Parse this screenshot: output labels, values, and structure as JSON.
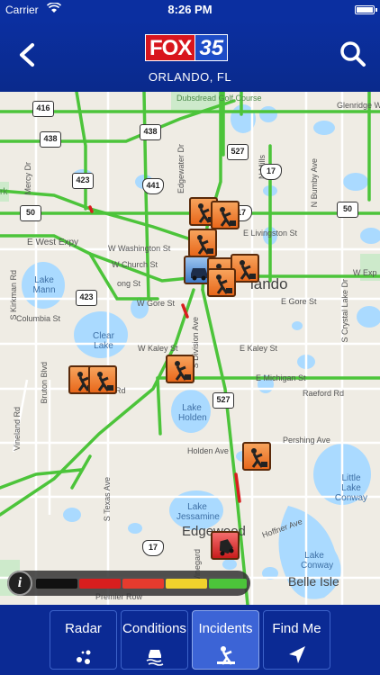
{
  "status_bar": {
    "carrier": "Carrier",
    "time": "8:26 PM"
  },
  "header": {
    "logo_fox": "FOX",
    "logo_number": "35",
    "location": "ORLANDO, FL"
  },
  "map": {
    "labels": {
      "dubsdread": "Dubsdread Golf Course",
      "glenridge": "Glenridge W",
      "mercy": "Mercy Dr",
      "edgewater": "Edgewater Dr",
      "mills": "N Mills",
      "bumby": "N Bumby Ave",
      "park": "rk",
      "west_expy": "E West Expy",
      "washington": "W Washington St",
      "livingston": "E Livingston St",
      "church": "W Church St",
      "long_st": "ong St",
      "west_exp_right": "W Exp",
      "kirkman": "S Kirkman Rd",
      "columbia": "Columbia St",
      "gore_w": "W Gore St",
      "gore_e": "E Gore St",
      "crystal_lake": "S Crystal Lake Dr",
      "kaley_w": "W Kaley St",
      "kaley_e": "E Kaley St",
      "division": "S Division Ave",
      "michigan": "E Michigan St",
      "raeford": "Raeford Rd",
      "bruton": "Bruton Blvd",
      "vineland": "Vineland Rd",
      "pershing": "Pershing Ave",
      "holden": "Holden Ave",
      "texas": "S Texas Ave",
      "winegard": "Winegard",
      "hoffner": "Hoffner Ave",
      "premier": "Premier Row",
      "orlando": "lando",
      "edgewood": "Edgewood",
      "belle_isle": "Belle Isle",
      "lake_mann": "Lake Mann",
      "clear_lake": "Clear Lake",
      "lake_holden": "Lake Holden",
      "lake_jessamine": "Lake Jessamine",
      "little_lake_conway": "Little Lake Conway",
      "lake_conway": "Lake Conway",
      "rd": "Rd"
    },
    "shields": [
      "416",
      "438",
      "438",
      "527",
      "441",
      "423",
      "50",
      "17",
      "50",
      "423",
      "527",
      "17",
      "17"
    ]
  },
  "legend": {
    "info_label": "i",
    "levels": [
      "stopped",
      "heavy",
      "moderate",
      "light",
      "free-flow"
    ],
    "colors": [
      "#111111",
      "#d81e1e",
      "#e63b2e",
      "#f0d22c",
      "#4cc43a"
    ]
  },
  "tabs": [
    {
      "label": "Radar",
      "icon": "radar-icon"
    },
    {
      "label": "Conditions",
      "icon": "skid-car-icon"
    },
    {
      "label": "Incidents",
      "icon": "incident-icon"
    },
    {
      "label": "Find Me",
      "icon": "location-arrow-icon"
    }
  ],
  "active_tab": "Incidents",
  "colors": {
    "header": "#0b2fa0",
    "traffic_free": "#4cc43a",
    "incident": "#e8671a"
  }
}
